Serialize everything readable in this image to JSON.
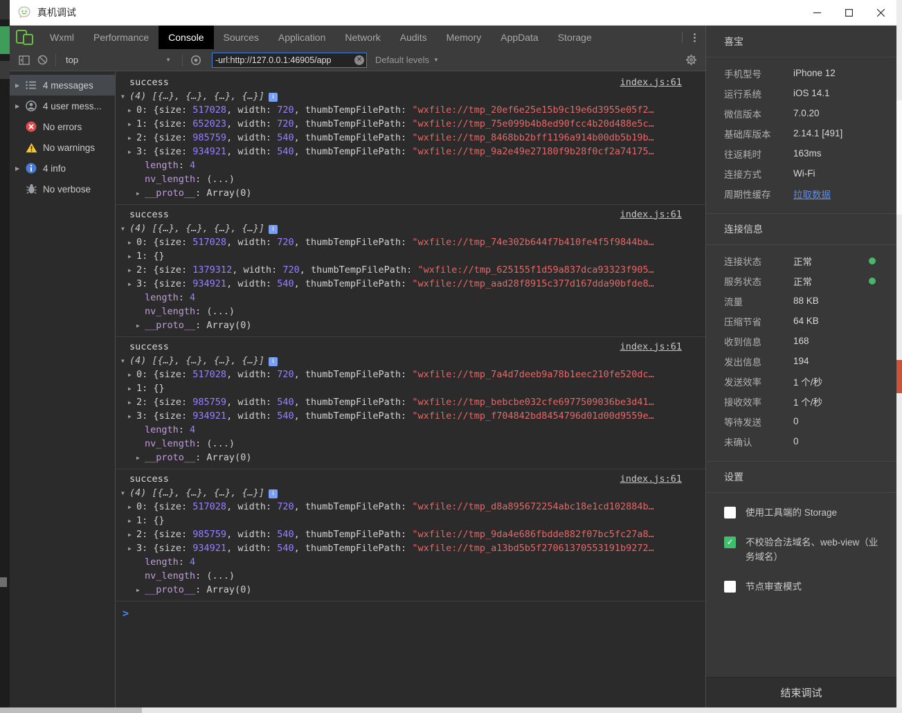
{
  "window": {
    "title": "真机调试"
  },
  "devtools": {
    "tabs": [
      {
        "label": "Wxml",
        "active": false
      },
      {
        "label": "Performance",
        "active": false
      },
      {
        "label": "Console",
        "active": true
      },
      {
        "label": "Sources",
        "active": false
      },
      {
        "label": "Application",
        "active": false
      },
      {
        "label": "Network",
        "active": false
      },
      {
        "label": "Audits",
        "active": false
      },
      {
        "label": "Memory",
        "active": false
      },
      {
        "label": "AppData",
        "active": false
      },
      {
        "label": "Storage",
        "active": false
      }
    ],
    "toolbar": {
      "context": "top",
      "filter_value": "-url:http://127.0.0.1:46905/app",
      "levels": "Default levels"
    },
    "sidebar": [
      {
        "icon": "list",
        "label": "4 messages",
        "expandable": true,
        "selected": true
      },
      {
        "icon": "user",
        "label": "4 user mess...",
        "expandable": true,
        "selected": false
      },
      {
        "icon": "error",
        "label": "No errors",
        "expandable": false,
        "selected": false
      },
      {
        "icon": "warning",
        "label": "No warnings",
        "expandable": false,
        "selected": false
      },
      {
        "icon": "info",
        "label": "4 info",
        "expandable": true,
        "selected": false
      },
      {
        "icon": "bug",
        "label": "No verbose",
        "expandable": false,
        "selected": false
      }
    ],
    "console": {
      "prompt": ">",
      "groups": [
        {
          "label": "success",
          "source": "index.js:61",
          "preview": "(4) [{…}, {…}, {…}, {…}]",
          "items": [
            {
              "key": "0",
              "size": "517028",
              "width": "720",
              "thumb": "wxfile://tmp_20ef6e25e15b9c19e6d3955e05f2"
            },
            {
              "key": "1",
              "size": "652023",
              "width": "720",
              "thumb": "wxfile://tmp_75e099b4b8ed90fcc4b20d488e5c"
            },
            {
              "key": "2",
              "size": "985759",
              "width": "540",
              "thumb": "wxfile://tmp_8468bb2bff1196a914b00db5b19b"
            },
            {
              "key": "3",
              "size": "934921",
              "width": "540",
              "thumb": "wxfile://tmp_9a2e49e27180f9b28f0cf2a74175"
            }
          ],
          "length": "4",
          "nv_length": "(...)",
          "proto": "Array(0)"
        },
        {
          "label": "success",
          "source": "index.js:61",
          "preview": "(4) [{…}, {…}, {…}, {…}]",
          "items": [
            {
              "key": "0",
              "size": "517028",
              "width": "720",
              "thumb": "wxfile://tmp_74e302b644f7b410fe4f5f9844ba"
            },
            {
              "key": "1",
              "empty": true
            },
            {
              "key": "2",
              "size": "1379312",
              "width": "720",
              "thumb": "wxfile://tmp_625155f1d59a837dca93323f905"
            },
            {
              "key": "3",
              "size": "934921",
              "width": "540",
              "thumb": "wxfile://tmp_aad28f8915c377d167dda90bfde8"
            }
          ],
          "length": "4",
          "nv_length": "(...)",
          "proto": "Array(0)"
        },
        {
          "label": "success",
          "source": "index.js:61",
          "preview": "(4) [{…}, {…}, {…}, {…}]",
          "items": [
            {
              "key": "0",
              "size": "517028",
              "width": "720",
              "thumb": "wxfile://tmp_7a4d7deeb9a78b1eec210fe520dc"
            },
            {
              "key": "1",
              "empty": true
            },
            {
              "key": "2",
              "size": "985759",
              "width": "540",
              "thumb": "wxfile://tmp_bebcbe032cfe6977509036be3d41"
            },
            {
              "key": "3",
              "size": "934921",
              "width": "540",
              "thumb": "wxfile://tmp_f704842bd8454796d01d00d9559e"
            }
          ],
          "length": "4",
          "nv_length": "(...)",
          "proto": "Array(0)"
        },
        {
          "label": "success",
          "source": "index.js:61",
          "preview": "(4) [{…}, {…}, {…}, {…}]",
          "items": [
            {
              "key": "0",
              "size": "517028",
              "width": "720",
              "thumb": "wxfile://tmp_d8a895672254abc18e1cd102884b"
            },
            {
              "key": "1",
              "empty": true
            },
            {
              "key": "2",
              "size": "985759",
              "width": "540",
              "thumb": "wxfile://tmp_9da4e686fbdde882f07bc5fc27a8"
            },
            {
              "key": "3",
              "size": "934921",
              "width": "540",
              "thumb": "wxfile://tmp_a13bd5b5f27061370553191b9272"
            }
          ],
          "length": "4",
          "nv_length": "(...)",
          "proto": "Array(0)"
        }
      ]
    }
  },
  "panel": {
    "device_name": "喜宝",
    "device_info": [
      {
        "label": "手机型号",
        "value": "iPhone 12"
      },
      {
        "label": "运行系统",
        "value": "iOS 14.1"
      },
      {
        "label": "微信版本",
        "value": "7.0.20"
      },
      {
        "label": "基础库版本",
        "value": "2.14.1 [491]"
      },
      {
        "label": "往返耗时",
        "value": "163ms"
      },
      {
        "label": "连接方式",
        "value": "Wi-Fi"
      },
      {
        "label": "周期性缓存",
        "value": "拉取数据",
        "link": true
      }
    ],
    "connection_title": "连接信息",
    "connection_info": [
      {
        "label": "连接状态",
        "value": "正常",
        "dot": true
      },
      {
        "label": "服务状态",
        "value": "正常",
        "dot": true
      },
      {
        "label": "流量",
        "value": "88 KB"
      },
      {
        "label": "压缩节省",
        "value": "64 KB"
      },
      {
        "label": "收到信息",
        "value": "168"
      },
      {
        "label": "发出信息",
        "value": "194"
      },
      {
        "label": "发送效率",
        "value": "1 个/秒"
      },
      {
        "label": "接收效率",
        "value": "1 个/秒"
      },
      {
        "label": "等待发送",
        "value": "0"
      },
      {
        "label": "未确认",
        "value": "0"
      }
    ],
    "settings_title": "设置",
    "settings": [
      {
        "label": "使用工具端的 Storage",
        "checked": false
      },
      {
        "label": "不校验合法域名、web-view（业务域名）",
        "checked": true
      },
      {
        "label": "节点审查模式",
        "checked": false
      }
    ],
    "end_button": "结束调试"
  },
  "colors": {
    "accent_blue": "#4a8af4",
    "status_green": "#48b768",
    "checkbox_green": "#3fbf6c",
    "error_red": "#e04a4a",
    "warning_yellow": "#f5c731",
    "info_blue": "#4b7bd5",
    "number_purple": "#9980ff",
    "string_red": "#e66767",
    "key_purple": "#c39be0",
    "link_blue": "#5b8cf0",
    "devices_green": "#6bbf3f"
  }
}
